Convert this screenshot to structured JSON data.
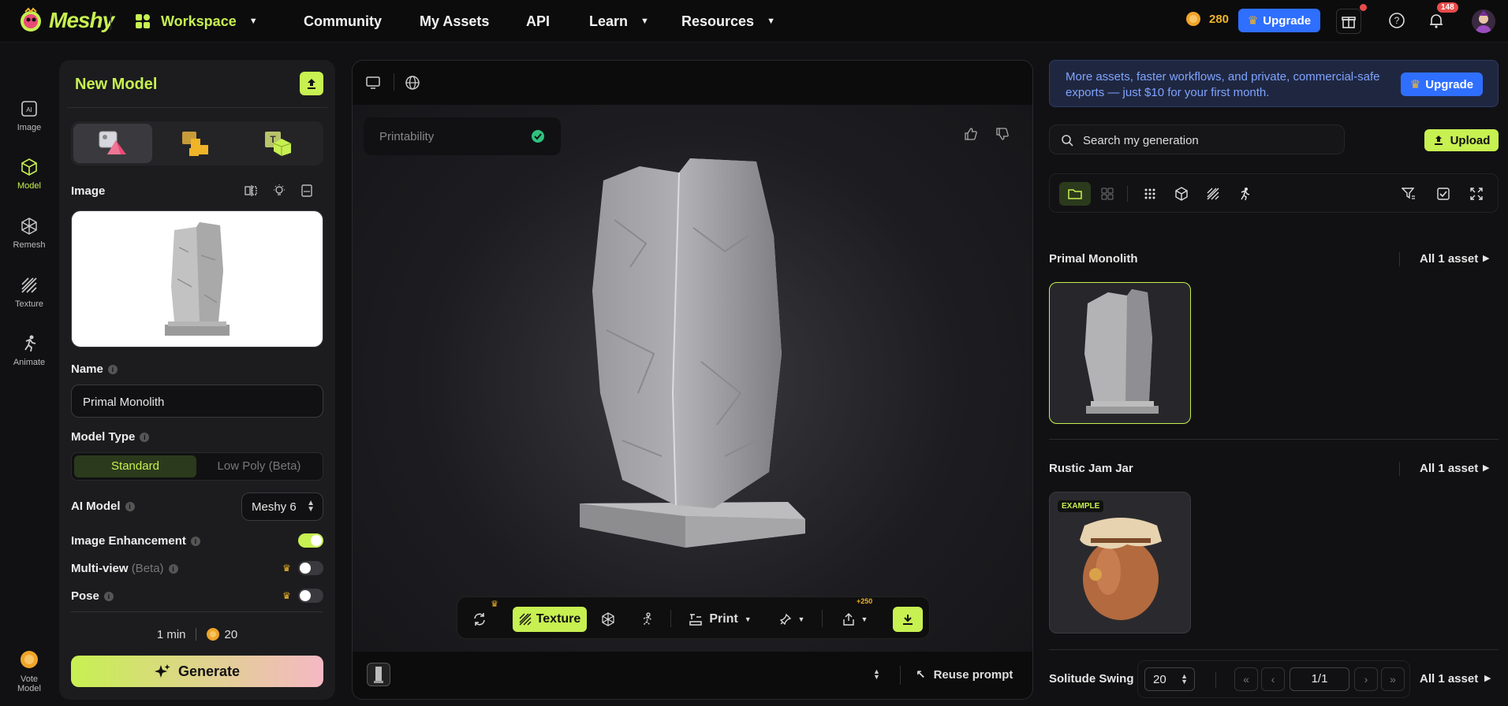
{
  "app": {
    "name": "Meshy"
  },
  "nav": {
    "workspace": "Workspace",
    "community": "Community",
    "my_assets": "My Assets",
    "api": "API",
    "learn": "Learn",
    "resources": "Resources"
  },
  "header": {
    "credits": "280",
    "upgrade_label": "Upgrade",
    "notifications_count": "148"
  },
  "rail": {
    "items": [
      "Image",
      "Model",
      "Remesh",
      "Texture",
      "Animate"
    ],
    "vote_line1": "Vote",
    "vote_line2": "Model"
  },
  "panel": {
    "title": "New Model",
    "image_label": "Image",
    "name_label": "Name",
    "name_value": "Primal Monolith",
    "model_type_label": "Model Type",
    "model_type_options": [
      "Standard",
      "Low Poly (Beta)"
    ],
    "ai_model_label": "AI Model",
    "ai_model_value": "Meshy 6",
    "image_enhancement_label": "Image Enhancement",
    "image_enhancement_on": true,
    "multiview_label": "Multi-view",
    "multiview_beta": "(Beta)",
    "multiview_on": false,
    "pose_label": "Pose",
    "pose_on": false,
    "time_estimate": "1 min",
    "cost": "20",
    "generate_label": "Generate"
  },
  "viewport": {
    "printability_label": "Printability",
    "toolbar": {
      "texture_label": "Texture",
      "print_label": "Print",
      "bonus": "+250"
    },
    "reuse_prompt_label": "Reuse prompt"
  },
  "right": {
    "banner_text": "More assets, faster workflows, and private, commercial-safe exports — just $10 for your first month.",
    "banner_upgrade": "Upgrade",
    "search_placeholder": "Search my generation",
    "upload_label": "Upload",
    "groups": [
      {
        "title": "Primal Monolith",
        "link": "All 1 asset"
      },
      {
        "title": "Rustic Jam Jar",
        "link": "All 1 asset",
        "badge": "EXAMPLE"
      },
      {
        "title": "Solitude Swing",
        "link": "All 1 asset"
      }
    ],
    "page_size": "20",
    "page_indicator": "1/1"
  },
  "colors": {
    "accent": "#c7f051",
    "blue": "#2f6fff",
    "bg": "#111113",
    "panel": "#1c1c1e"
  }
}
